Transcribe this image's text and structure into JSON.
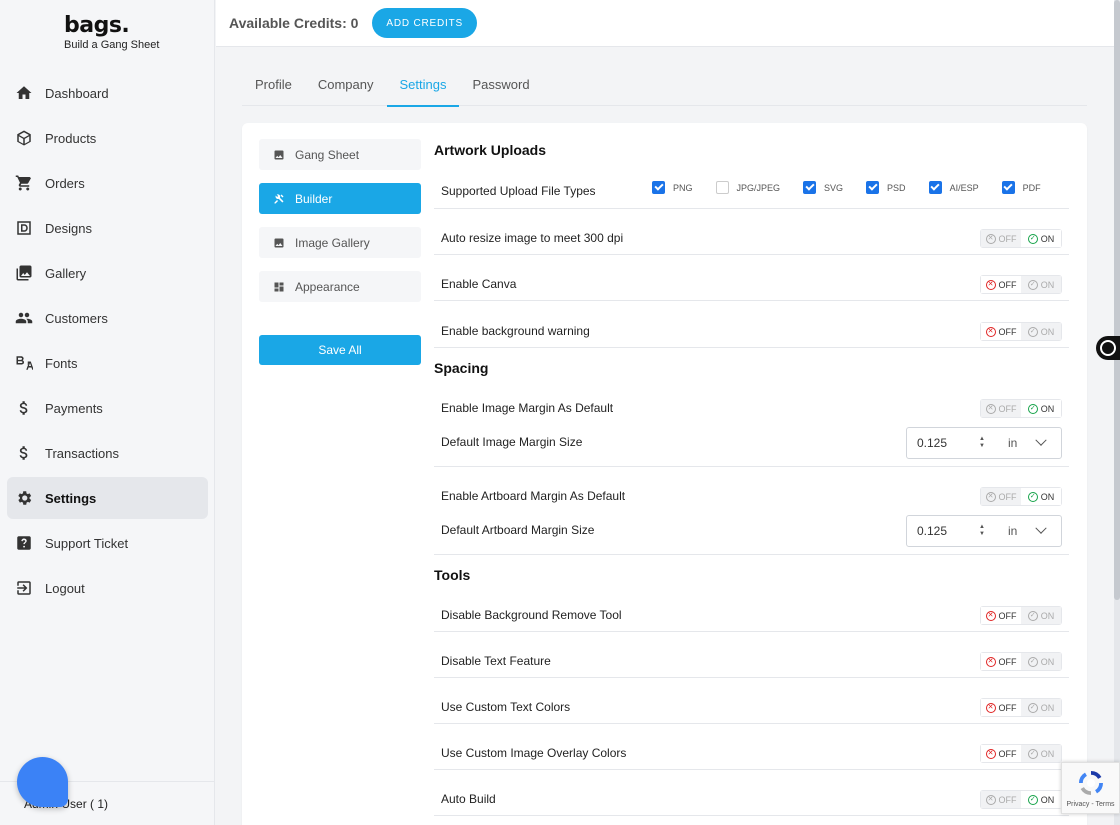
{
  "brand": {
    "name": "bags.",
    "tagline": "Build a Gang Sheet"
  },
  "sidebar": {
    "items": [
      {
        "label": "Dashboard",
        "icon": "home-icon"
      },
      {
        "label": "Products",
        "icon": "box-icon"
      },
      {
        "label": "Orders",
        "icon": "cart-icon"
      },
      {
        "label": "Designs",
        "icon": "designs-icon"
      },
      {
        "label": "Gallery",
        "icon": "gallery-icon"
      },
      {
        "label": "Customers",
        "icon": "people-icon"
      },
      {
        "label": "Fonts",
        "icon": "font-icon"
      },
      {
        "label": "Payments",
        "icon": "dollar-icon"
      },
      {
        "label": "Transactions",
        "icon": "dollar-icon"
      },
      {
        "label": "Settings",
        "icon": "gear-icon",
        "active": true
      },
      {
        "label": "Support Ticket",
        "icon": "help-icon"
      },
      {
        "label": "Logout",
        "icon": "logout-icon"
      }
    ],
    "user": "Admin User ( 1)"
  },
  "header": {
    "credits_label": "Available Credits: 0",
    "add_credits": "ADD CREDITS"
  },
  "tabs": [
    {
      "label": "Profile"
    },
    {
      "label": "Company"
    },
    {
      "label": "Settings",
      "active": true
    },
    {
      "label": "Password"
    }
  ],
  "subnav": [
    {
      "label": "Gang Sheet",
      "icon": "image-icon"
    },
    {
      "label": "Builder",
      "icon": "tools-icon",
      "active": true
    },
    {
      "label": "Image Gallery",
      "icon": "image-icon"
    },
    {
      "label": "Appearance",
      "icon": "dashboard-icon"
    }
  ],
  "save_all": "Save All",
  "toggle": {
    "off": "OFF",
    "on": "ON"
  },
  "artwork": {
    "title": "Artwork Uploads",
    "upload_label": "Supported Upload File Types",
    "file_types": [
      {
        "label": "PNG",
        "checked": true
      },
      {
        "label": "JPG/JPEG",
        "checked": false
      },
      {
        "label": "SVG",
        "checked": true
      },
      {
        "label": "PSD",
        "checked": true
      },
      {
        "label": "AI/ESP",
        "checked": true
      },
      {
        "label": "PDF",
        "checked": true
      }
    ],
    "rows": [
      {
        "label": "Auto resize image to meet 300 dpi",
        "value": "on"
      },
      {
        "label": "Enable Canva",
        "value": "off"
      },
      {
        "label": "Enable background warning",
        "value": "off"
      }
    ]
  },
  "spacing": {
    "title": "Spacing",
    "image_margin_toggle": {
      "label": "Enable Image Margin As Default",
      "value": "on"
    },
    "image_margin_size": {
      "label": "Default Image Margin Size",
      "value": "0.125",
      "unit": "in"
    },
    "artboard_margin_toggle": {
      "label": "Enable Artboard Margin As Default",
      "value": "on"
    },
    "artboard_margin_size": {
      "label": "Default Artboard Margin Size",
      "value": "0.125",
      "unit": "in"
    }
  },
  "tools": {
    "title": "Tools",
    "rows": [
      {
        "label": "Disable Background Remove Tool",
        "value": "off"
      },
      {
        "label": "Disable Text Feature",
        "value": "off"
      },
      {
        "label": "Use Custom Text Colors",
        "value": "off"
      },
      {
        "label": "Use Custom Image Overlay Colors",
        "value": "off"
      },
      {
        "label": "Auto Build",
        "value": "on"
      }
    ]
  },
  "recaptcha": {
    "text": "Privacy - Terms"
  },
  "colors": {
    "accent": "#1aa7e6",
    "checkbox": "#1a73e8",
    "off": "#e02424",
    "on": "#16a34a"
  }
}
